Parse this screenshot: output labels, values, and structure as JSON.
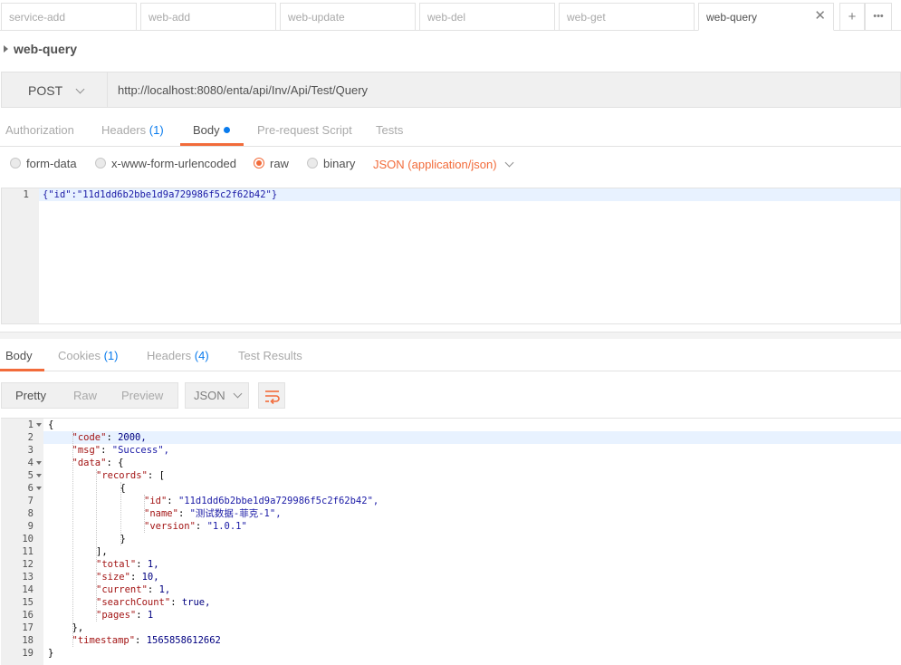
{
  "tabs": [
    {
      "label": "service-add"
    },
    {
      "label": "web-add"
    },
    {
      "label": "web-update"
    },
    {
      "label": "web-del"
    },
    {
      "label": "web-get"
    },
    {
      "label": "web-query",
      "active": true
    }
  ],
  "tab_actions": {
    "add": "+",
    "more": "•••",
    "close": "✕"
  },
  "request": {
    "name": "web-query",
    "method": "POST",
    "url": "http://localhost:8080/enta/api/Inv/Api/Test/Query"
  },
  "request_tabs": {
    "authorization": "Authorization",
    "headers": "Headers",
    "headers_count": "(1)",
    "body": "Body",
    "prerequest": "Pre-request Script",
    "tests": "Tests"
  },
  "body_types": {
    "form_data": "form-data",
    "urlencoded": "x-www-form-urlencoded",
    "raw": "raw",
    "binary": "binary",
    "content_type": "JSON (application/json)"
  },
  "request_body": {
    "line_number": "1",
    "code": "{\"id\":\"11d1dd6b2bbe1d9a729986f5c2f62b42\"}"
  },
  "response_tabs": {
    "body": "Body",
    "cookies": "Cookies",
    "cookies_count": "(1)",
    "headers": "Headers",
    "headers_count": "(4)",
    "test_results": "Test Results"
  },
  "response_toolbar": {
    "pretty": "Pretty",
    "raw": "Raw",
    "preview": "Preview",
    "format": "JSON"
  },
  "response_lines": [
    {
      "num": "1",
      "fold": true
    },
    {
      "num": "2",
      "key": "\"code\"",
      "value": "2000,"
    },
    {
      "num": "3",
      "key": "\"msg\"",
      "value": "\"Success\","
    },
    {
      "num": "4",
      "key": "\"data\"",
      "value": "{",
      "fold": true
    },
    {
      "num": "5",
      "key": "\"records\"",
      "value": "[",
      "fold": true
    },
    {
      "num": "6",
      "text": "{",
      "fold": true
    },
    {
      "num": "7",
      "key": "\"id\"",
      "value": "\"11d1dd6b2bbe1d9a729986f5c2f62b42\","
    },
    {
      "num": "8",
      "key": "\"name\"",
      "value": "\"测试数据-菲克-1\","
    },
    {
      "num": "9",
      "key": "\"version\"",
      "value": "\"1.0.1\""
    },
    {
      "num": "10",
      "text": "}"
    },
    {
      "num": "11",
      "text": "],"
    },
    {
      "num": "12",
      "key": "\"total\"",
      "value": "1,"
    },
    {
      "num": "13",
      "key": "\"size\"",
      "value": "10,"
    },
    {
      "num": "14",
      "key": "\"current\"",
      "value": "1,"
    },
    {
      "num": "15",
      "key": "\"searchCount\"",
      "value": "true,"
    },
    {
      "num": "16",
      "key": "\"pages\"",
      "value": "1"
    },
    {
      "num": "17",
      "text": "},"
    },
    {
      "num": "18",
      "key": "\"timestamp\"",
      "value": "1565858612662"
    },
    {
      "num": "19",
      "text": "}"
    }
  ],
  "response_line1_text": "{",
  "colors": {
    "accent": "#f26b3a",
    "count": "#097bed"
  }
}
